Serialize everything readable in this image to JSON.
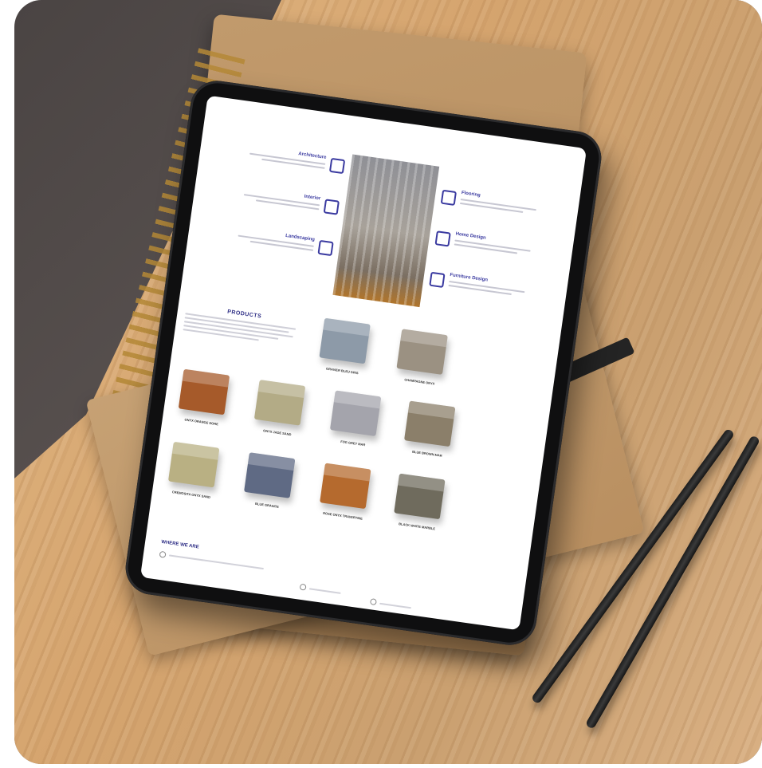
{
  "scene": {
    "description_tags": [
      "dark-desk-icon",
      "wood-board-icon",
      "notebook-icon",
      "pencil-icon",
      "tablet-icon"
    ]
  },
  "site": {
    "features_left": [
      {
        "title": "Architecture",
        "icon": "building-icon"
      },
      {
        "title": "Interior",
        "icon": "sofa-icon"
      },
      {
        "title": "Landscaping",
        "icon": "landscape-icon"
      }
    ],
    "features_right": [
      {
        "title": "Flooring",
        "icon": "floor-icon"
      },
      {
        "title": "Home Design",
        "icon": "home-icon"
      },
      {
        "title": "Furniture Design",
        "icon": "chair-icon"
      }
    ],
    "products_title": "PRODUCTS",
    "products": [
      {
        "name": "GRAVIER BLEU GRIS",
        "color": "#8d9aa8"
      },
      {
        "name": "CHAMPAGNE ONYX",
        "color": "#9b9182"
      },
      {
        "name": "ONYX ORANGE DORE",
        "color": "#a65a2a"
      },
      {
        "name": "ONYX JADE SAND",
        "color": "#b3ab86"
      },
      {
        "name": "FOG GREY MAR",
        "color": "#a4a4ac"
      },
      {
        "name": "BLUE BROWN MAR",
        "color": "#8b7f6a"
      },
      {
        "name": "CREMOSITA ONYX SAND",
        "color": "#b9b083"
      },
      {
        "name": "BLUE GRANITE",
        "color": "#5f6a84"
      },
      {
        "name": "ROSE ONYX TRAVERTINE",
        "color": "#b56a2e"
      },
      {
        "name": "BLACK WHITE MARBLE",
        "color": "#6f6b5d"
      }
    ],
    "footer_title": "WHERE WE ARE"
  }
}
